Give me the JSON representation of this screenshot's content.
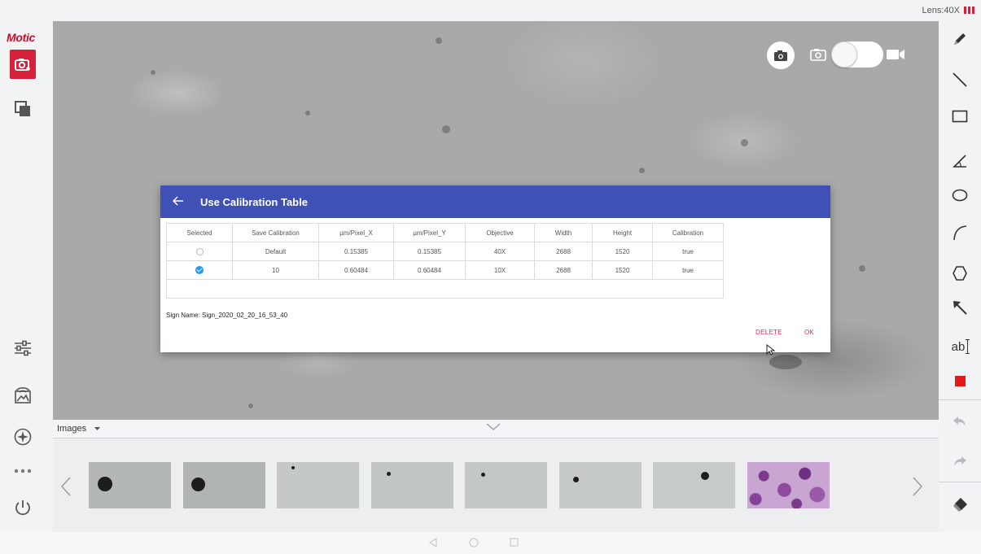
{
  "status_bar": {
    "lens": "Lens:40X"
  },
  "app": {
    "logo": "Motic"
  },
  "left_sidebar": {
    "items": [
      {
        "icon": "camera-icon"
      },
      {
        "icon": "gallery-icon"
      },
      {
        "icon": "adjust-sliders-icon"
      },
      {
        "icon": "wifi-image-icon"
      },
      {
        "icon": "compass-icon"
      },
      {
        "icon": "more-icon"
      },
      {
        "icon": "power-icon"
      }
    ]
  },
  "right_toolbar": {
    "tools": [
      "pencil-icon",
      "line-icon",
      "rectangle-icon",
      "angle-icon",
      "ellipse-icon",
      "arc-icon",
      "polygon-icon",
      "arrow-icon",
      "text-icon",
      "color-swatch-icon",
      "undo-icon",
      "redo-icon",
      "eraser-icon"
    ],
    "text_tool_label": "ab",
    "active_color": "#e21a1a"
  },
  "capture": {
    "mode": "photo"
  },
  "dialog": {
    "title": "Use Calibration Table",
    "columns": [
      "Selected",
      "Save Calibration",
      "µm/Pixel_X",
      "µm/Pixel_Y",
      "Objective",
      "Width",
      "Height",
      "Calibration"
    ],
    "rows": [
      {
        "selected": false,
        "save_calibration": "Default",
        "um_pixel_x": "0.15385",
        "um_pixel_y": "0.15385",
        "objective": "40X",
        "width": "2688",
        "height": "1520",
        "calibration": "true"
      },
      {
        "selected": true,
        "save_calibration": "10",
        "um_pixel_x": "0.60484",
        "um_pixel_y": "0.60484",
        "objective": "10X",
        "width": "2688",
        "height": "1520",
        "calibration": "true"
      }
    ],
    "sign_name": "Sign Name: Sign_2020_02_20_16_53_40",
    "delete_label": "DELETE",
    "ok_label": "OK"
  },
  "images_panel": {
    "dropdown_label": "Images"
  },
  "theme": {
    "primary": "#3f51b5",
    "accent": "#e91e63",
    "brand_red": "#d6213a",
    "radio_checked": "#2196f3"
  }
}
